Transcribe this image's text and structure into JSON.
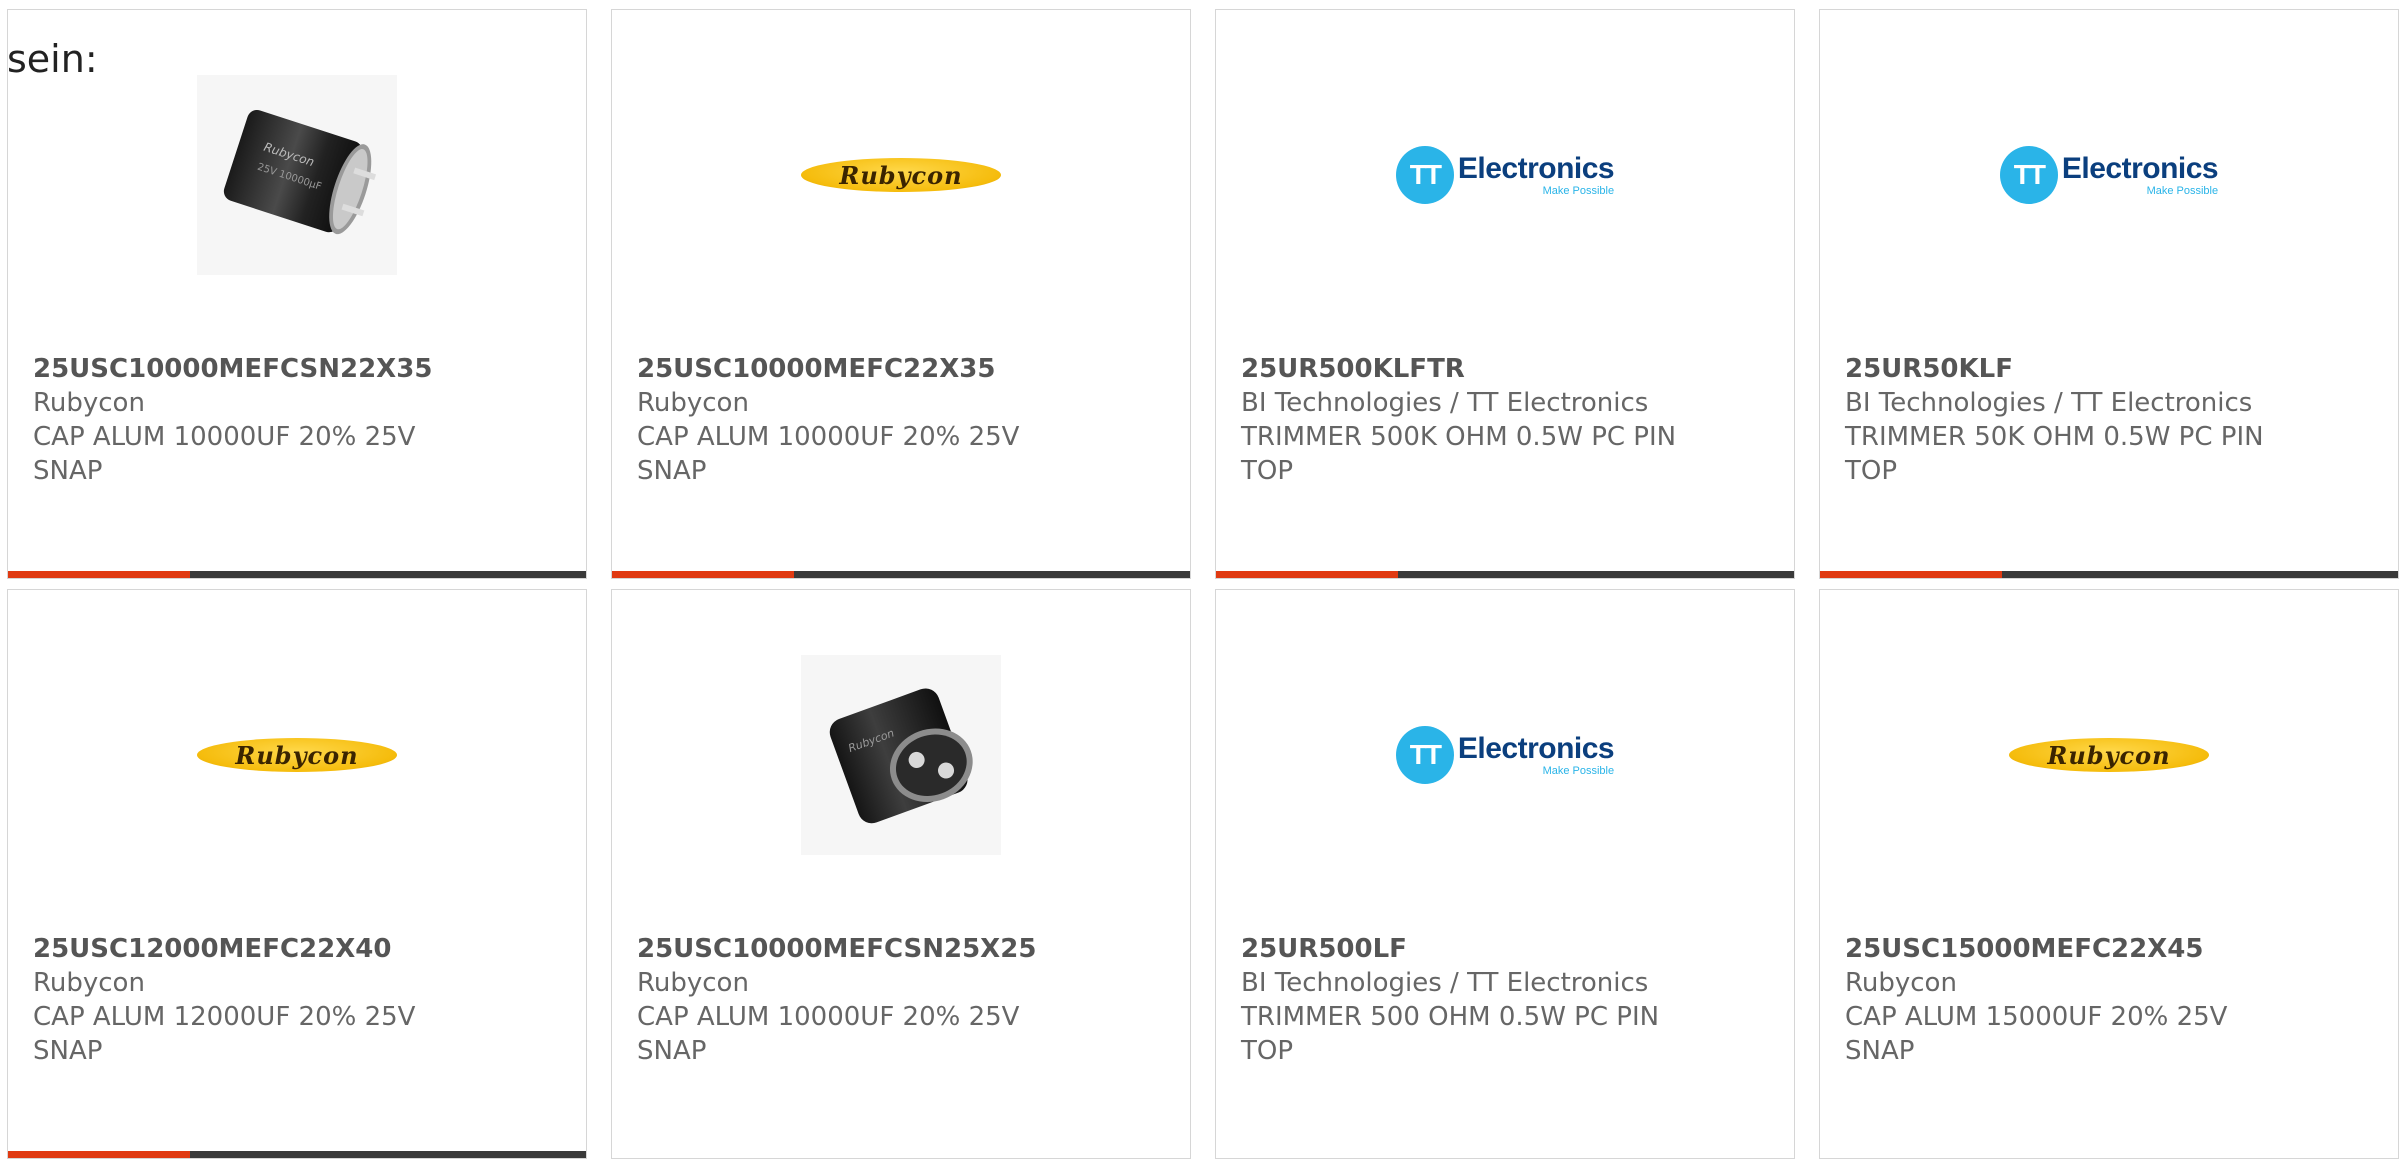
{
  "intro_text": "sein:",
  "colors": {
    "accent_bar": "#e03a12",
    "bar": "#3a3a3a",
    "rubycon_logo": "#f5bc0c",
    "tt_blue": "#2ab4e8",
    "tt_navy": "#0b3f7e"
  },
  "logos": {
    "rubycon": "Rubycon",
    "tt_initials": "TT",
    "tt_word": "Electronics",
    "tt_tagline": "Make Possible"
  },
  "products": [
    {
      "part": "25USC10000MEFCSN22X35",
      "manufacturer": "Rubycon",
      "description": "CAP ALUM 10000UF 20% 25V SNAP",
      "image": "capacitor-photo-side"
    },
    {
      "part": "25USC10000MEFC22X35",
      "manufacturer": "Rubycon",
      "description": "CAP ALUM 10000UF 20% 25V SNAP",
      "image": "rubycon-logo"
    },
    {
      "part": "25UR500KLFTR",
      "manufacturer": "BI Technologies / TT Electronics",
      "description": "TRIMMER 500K OHM 0.5W PC PIN TOP",
      "image": "tt-electronics-logo"
    },
    {
      "part": "25UR50KLF",
      "manufacturer": "BI Technologies / TT Electronics",
      "description": "TRIMMER 50K OHM 0.5W PC PIN TOP",
      "image": "tt-electronics-logo"
    },
    {
      "part": "25USC12000MEFC22X40",
      "manufacturer": "Rubycon",
      "description": "CAP ALUM 12000UF 20% 25V SNAP",
      "image": "rubycon-logo"
    },
    {
      "part": "25USC10000MEFCSN25X25",
      "manufacturer": "Rubycon",
      "description": "CAP ALUM 10000UF 20% 25V SNAP",
      "image": "capacitor-photo-top"
    },
    {
      "part": "25UR500LF",
      "manufacturer": "BI Technologies / TT Electronics",
      "description": "TRIMMER 500 OHM 0.5W PC PIN TOP",
      "image": "tt-electronics-logo"
    },
    {
      "part": "25USC15000MEFC22X45",
      "manufacturer": "Rubycon",
      "description": "CAP ALUM 15000UF 20% 25V SNAP",
      "image": "rubycon-logo"
    }
  ]
}
